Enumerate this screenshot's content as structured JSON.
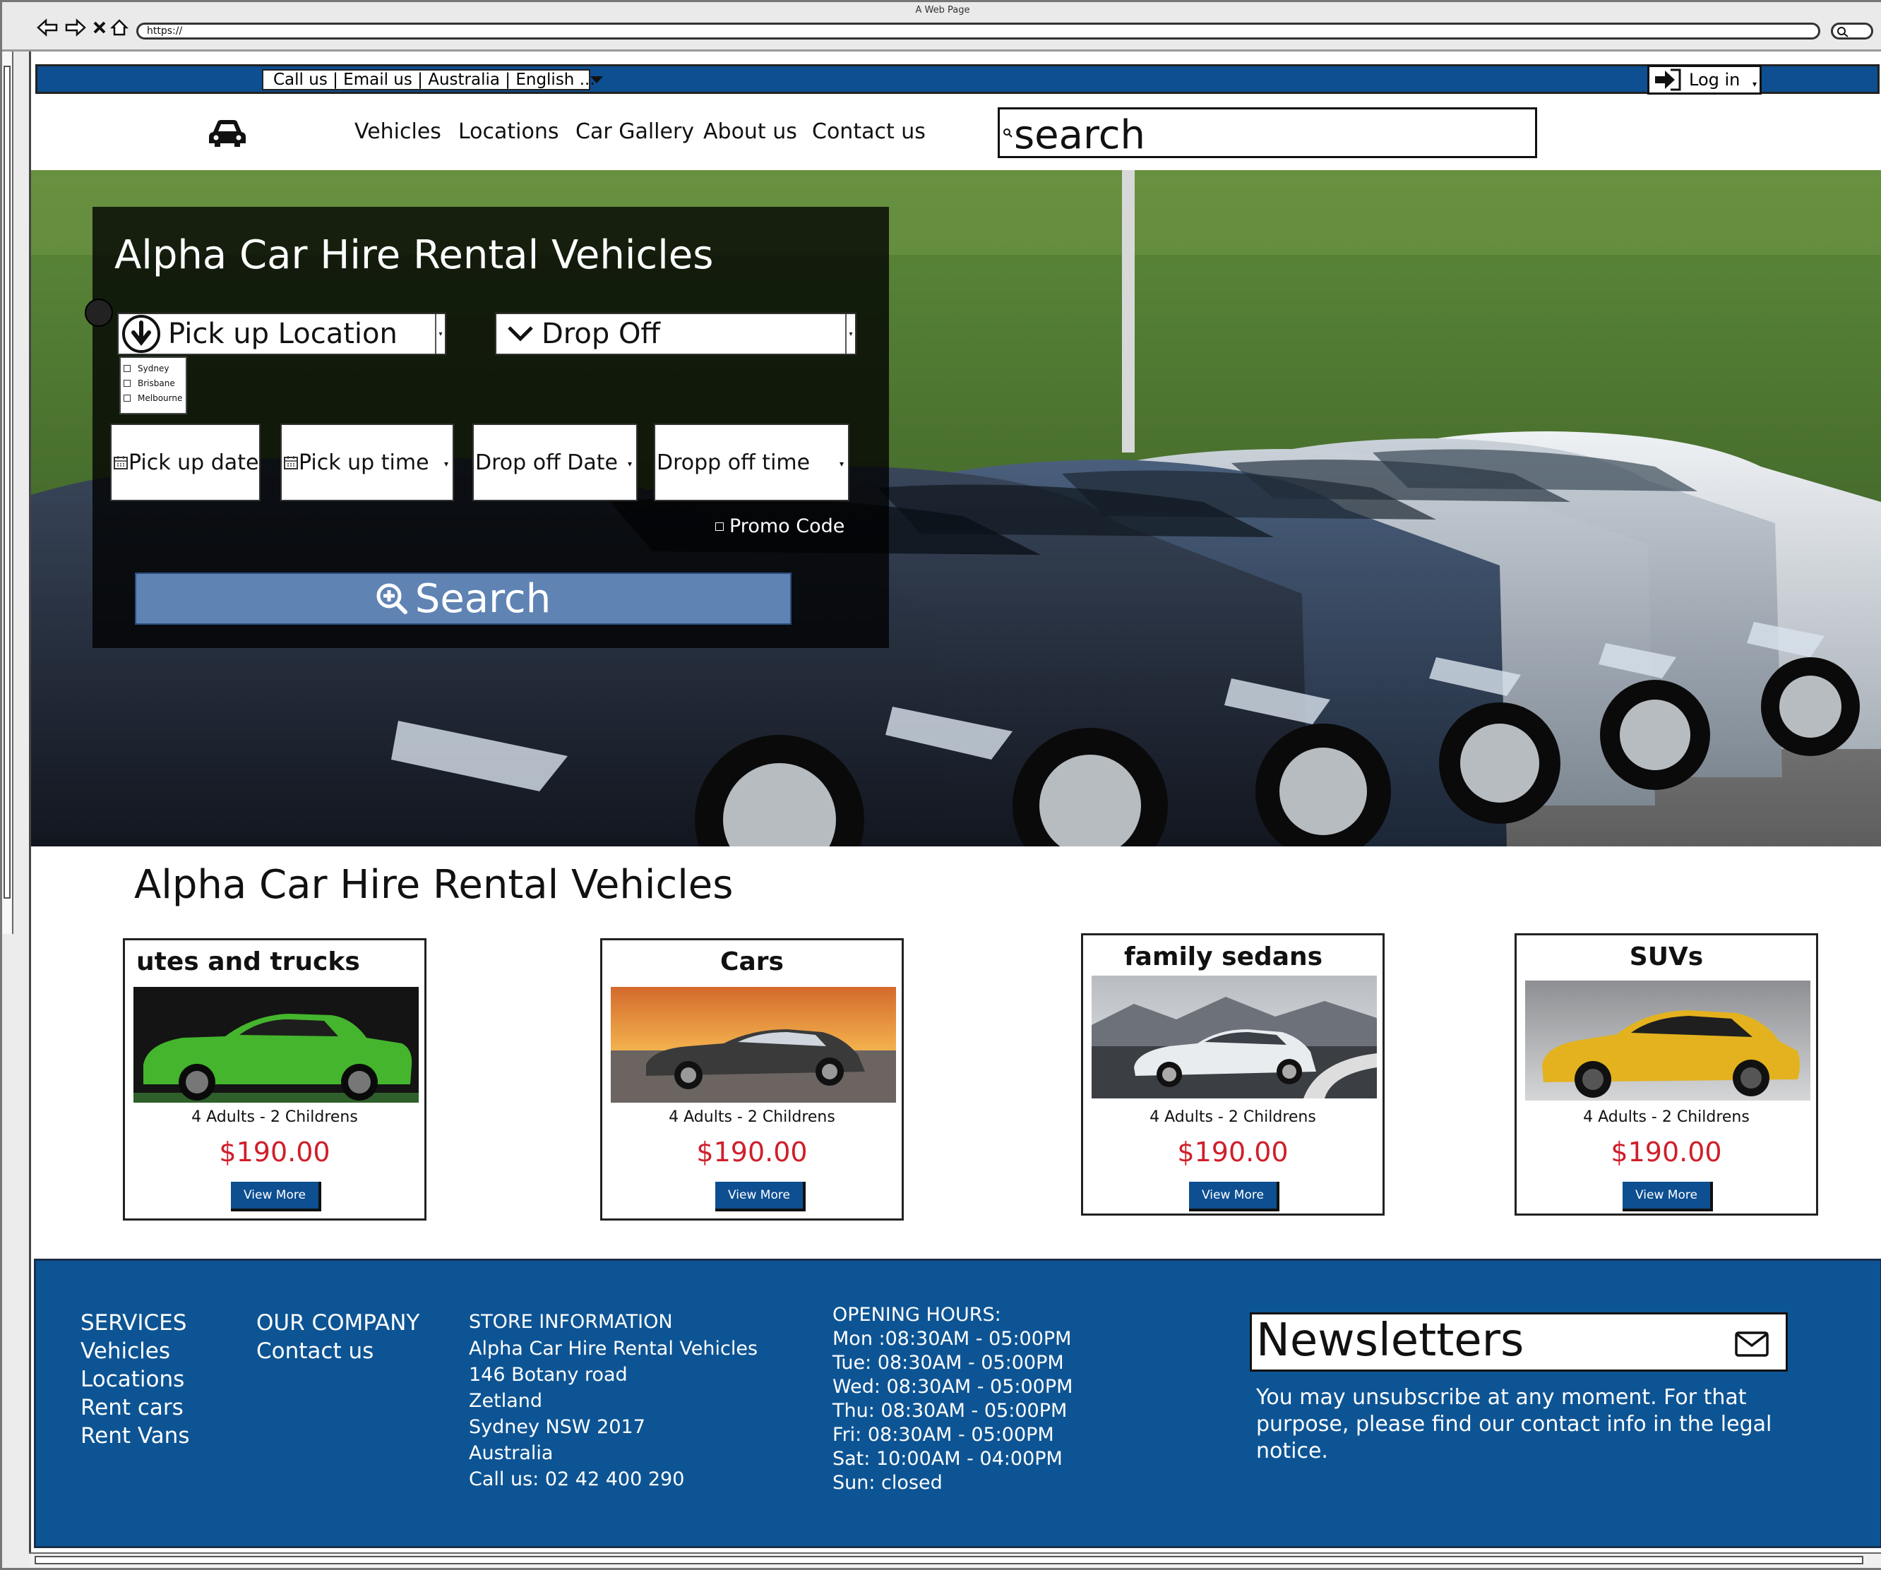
{
  "browser": {
    "window_title": "A Web Page",
    "address": "https://"
  },
  "topbar": {
    "contact_select": "Call us | Email us | Australia | English ...",
    "login_label": "Log in"
  },
  "nav": {
    "links": [
      "Vehicles",
      "Locations",
      "Car Gallery",
      "About us",
      "Contact us"
    ],
    "search_placeholder": "search"
  },
  "hero": {
    "title": "Alpha Car Hire Rental Vehicles",
    "pickup_location_label": "Pick up Location",
    "pickup_locations": [
      "Sydney",
      "Brisbane",
      "Melbourne"
    ],
    "dropoff_label": "Drop Off",
    "pickup_date_label": "Pick up date",
    "pickup_time_label": "Pick up time",
    "dropoff_date_label": "Drop off Date",
    "dropoff_time_label": "Dropp off time",
    "promo_label": "Promo Code",
    "search_button": "Search"
  },
  "vehicles": {
    "section_title": "Alpha Car Hire Rental Vehicles",
    "cards": [
      {
        "title": "utes and trucks",
        "pax": "4 Adults - 2 Childrens",
        "price": "$190.00",
        "button": "View More",
        "body_color": "#3fae2a"
      },
      {
        "title": "Cars",
        "pax": "4 Adults - 2 Childrens",
        "price": "$190.00",
        "button": "View More",
        "body_color": "#3a3a3a"
      },
      {
        "title": "family sedans",
        "pax": "4 Adults - 2 Childrens",
        "price": "$190.00",
        "button": "View More",
        "body_color": "#e8eaec"
      },
      {
        "title": "SUVs",
        "pax": "4 Adults - 2 Childrens",
        "price": "$190.00",
        "button": "View More",
        "body_color": "#e3b21e"
      }
    ]
  },
  "footer": {
    "services": {
      "heading": "SERVICES",
      "items": [
        "Vehicles",
        "Locations",
        "Rent cars",
        "Rent Vans"
      ]
    },
    "company": {
      "heading": "OUR COMPANY",
      "items": [
        "Contact us"
      ]
    },
    "store": {
      "heading": "STORE INFORMATION",
      "lines": [
        "Alpha Car Hire Rental Vehicles",
        "146 Botany road",
        "Zetland",
        "Sydney NSW 2017",
        "Australia",
        "Call us: 02 42 400 290"
      ]
    },
    "hours": {
      "heading": "OPENING HOURS:",
      "lines": [
        "Mon :08:30AM - 05:00PM",
        "Tue: 08:30AM - 05:00PM",
        "Wed: 08:30AM - 05:00PM",
        "Thu: 08:30AM - 05:00PM",
        "Fri: 08:30AM - 05:00PM",
        "Sat: 10:00AM - 04:00PM",
        "Sun: closed"
      ]
    },
    "newsletter": {
      "title": "Newsletters",
      "text": "You may unsubscribe at any moment. For that purpose, please find our contact info in the legal notice."
    }
  },
  "colors": {
    "brand_blue": "#0d4f91",
    "footer_blue": "#0d5494",
    "search_button": "#5f83b3",
    "price_red": "#cf1f2a"
  },
  "icons": [
    "back-icon",
    "forward-icon",
    "stop-icon",
    "home-icon",
    "login-arrow-icon",
    "car-logo-icon",
    "search-icon",
    "down-arrow-circle-icon",
    "chevron-down-icon",
    "calendar-icon",
    "zoom-search-icon",
    "mail-icon"
  ]
}
